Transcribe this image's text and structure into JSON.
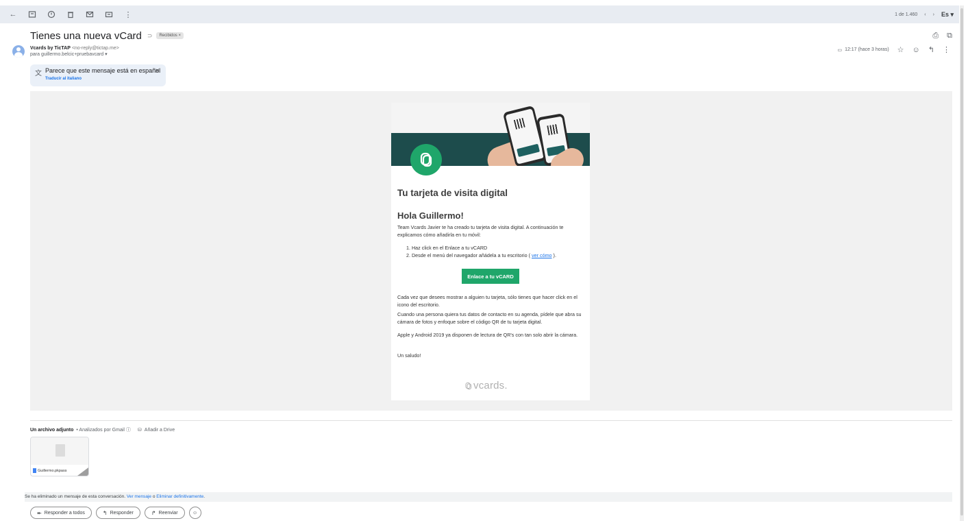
{
  "toolbar": {
    "pagination": "1 de 1.460",
    "lang": "Es"
  },
  "message": {
    "subject": "Tienes una nueva vCard",
    "label": "Recibidos ×",
    "sender_name": "Vcards by TicTAP",
    "sender_email": "<no-reply@tictap.me>",
    "recipient": "para guillermo.belcic+pruebavcard ▾",
    "time": "12:17 (hace 3 horas)"
  },
  "translate": {
    "text": "Parece que este mensaje está en español",
    "link": "Traducir al italiano"
  },
  "card": {
    "title": "Tu tarjeta de visita digital",
    "greeting": "Hola Guillermo!",
    "intro": "Team Vcards Javier te ha creado tu tarjeta de visita digital. A continuación te explicamos cómo añadirla en tu móvil:",
    "step1": "1. Haz click en el Enlace a tu vCARD",
    "step2_before": "2. Desde el menú del navegador añádela a tu escritorio ( ",
    "step2_link": "ver cómo",
    "step2_after": " ).",
    "cta": "Enlace a tu vCARD",
    "para1": "Cada vez que desees mostrar a alguien tu tarjeta, sólo tienes que hacer click en el icono del escritorio.",
    "para2": "Cuando una persona quiera tus datos de contacto en su agenda, pídele que abra su cámara de fotos y enfoque sobre el código QR de tu tarjeta digital.",
    "para3": "Apple y Android 2019 ya disponen de lectura de QR's con tan solo abrir la cámara.",
    "signoff": "Un saludo!",
    "footer_logo": "vcards."
  },
  "attachment": {
    "title": "Un archivo adjunto",
    "scanned": "• Analizados por Gmail ⓘ",
    "drive": "Añadir a Drive",
    "filename": "Guillermo.pkpass"
  },
  "deleted": {
    "text": "Se ha eliminado un mensaje de esta conversación. ",
    "view": "Ver mensaje",
    "or": " o ",
    "delete": "Eliminar definitivamente",
    "end": "."
  },
  "replies": {
    "reply_all": "Responder a todos",
    "reply": "Responder",
    "forward": "Reenviar"
  },
  "colors": {
    "brand_green": "#1fa66a",
    "hero_band": "#1d4c4c",
    "link_blue": "#1a73e8"
  }
}
